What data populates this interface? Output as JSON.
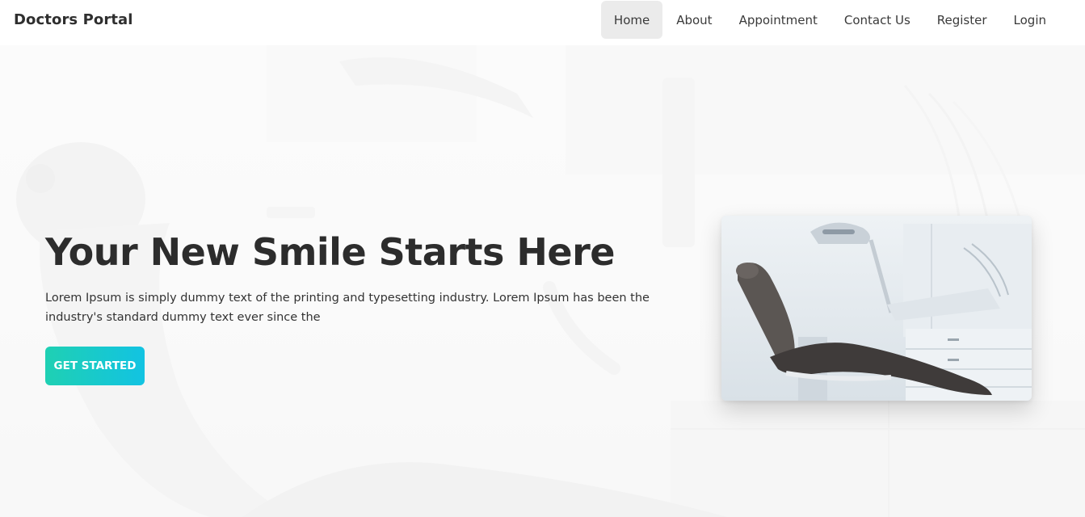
{
  "navbar": {
    "brand": "Doctors Portal",
    "items": [
      {
        "label": "Home",
        "active": true
      },
      {
        "label": "About",
        "active": false
      },
      {
        "label": "Appointment",
        "active": false
      },
      {
        "label": "Contact Us",
        "active": false
      },
      {
        "label": "Register",
        "active": false
      },
      {
        "label": "Login",
        "active": false
      }
    ]
  },
  "hero": {
    "title": "Your New Smile Starts Here",
    "text": "Lorem Ipsum is simply dummy text of the printing and typesetting industry. Lorem Ipsum has been the industry's standard dummy text ever since the",
    "button_label": "GET STARTED",
    "button_colors": [
      "#1fd0b3",
      "#12c3e2"
    ]
  }
}
